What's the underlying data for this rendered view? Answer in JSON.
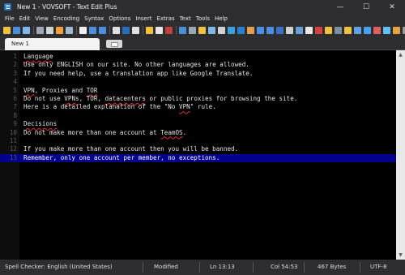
{
  "window": {
    "title": "New 1 - VOVSOFT - Text Edit Plus",
    "minimize": "—",
    "maximize": "☐",
    "close": "✕"
  },
  "menu": [
    "File",
    "Edit",
    "View",
    "Encoding",
    "Syntax",
    "Options",
    "Insert",
    "Extras",
    "Text",
    "Tools",
    "Help"
  ],
  "toolbar": {
    "icon_colors": [
      "#f0c040",
      "#4a90d9",
      "#7fb8e8",
      "#9fa8b8",
      "#cfd3d8",
      "#f2a03c",
      "#9fb8d0",
      "#f0f0f0",
      "#4a8fe0",
      "#4a8fe0",
      "#e0e0e0",
      "#2a6db8",
      "#e0e0e0",
      "#f0c040",
      "#e6e6e6",
      "#c04040",
      "#4a90d9",
      "#9aa8b6",
      "#f0c040",
      "#7fb8e8",
      "#d0d0d0",
      "#3fa0e0",
      "#2a80d0",
      "#e0a050",
      "#4a8fe0",
      "#4a8fe0",
      "#3a70c8",
      "#d0d0d0",
      "#6aa0d8",
      "#e8e8e8",
      "#d84040",
      "#f0c040",
      "#7a8fa0",
      "#f0c040",
      "#60a0e0",
      "#4aa0f0",
      "#e06060",
      "#60c0f0",
      "#e8a040",
      "#9a9a9a"
    ]
  },
  "tabs": [
    {
      "label": "New 1"
    }
  ],
  "editor": {
    "lines": [
      {
        "num": "1",
        "segments": [
          {
            "text": "Language",
            "spell": true
          }
        ]
      },
      {
        "num": "2",
        "segments": [
          {
            "text": "Use only ENGLISH on our site. No other languages are allowed."
          }
        ]
      },
      {
        "num": "3",
        "segments": [
          {
            "text": "If you need help, use a translation app like Google Translate."
          }
        ]
      },
      {
        "num": "4",
        "segments": [
          {
            "text": ""
          }
        ]
      },
      {
        "num": "5",
        "segments": [
          {
            "text": "VPN",
            "spell": true
          },
          {
            "text": ", Proxies and "
          },
          {
            "text": "TOR",
            "spell": true
          }
        ]
      },
      {
        "num": "6",
        "segments": [
          {
            "text": "Do not use "
          },
          {
            "text": "VPNs",
            "spell": true
          },
          {
            "text": ", TOR, "
          },
          {
            "text": "datacenters",
            "spell": true
          },
          {
            "text": " or public proxies for browsing the site."
          }
        ]
      },
      {
        "num": "7",
        "segments": [
          {
            "text": "Here is a detailed explanation of the \"No "
          },
          {
            "text": "VPN",
            "spell": true
          },
          {
            "text": "\" rule."
          }
        ]
      },
      {
        "num": "8",
        "segments": [
          {
            "text": ""
          }
        ]
      },
      {
        "num": "9",
        "segments": [
          {
            "text": "Decisions",
            "spell": true
          }
        ]
      },
      {
        "num": "10",
        "segments": [
          {
            "text": "Do not make more than one account at "
          },
          {
            "text": "TeamOS",
            "spell": true
          },
          {
            "text": "."
          }
        ]
      },
      {
        "num": "11",
        "segments": [
          {
            "text": ""
          }
        ]
      },
      {
        "num": "12",
        "segments": [
          {
            "text": "If you make more than one account then you will be banned."
          }
        ]
      },
      {
        "num": "13",
        "selected": true,
        "segments": [
          {
            "text": "Remember, only one account per member, no exceptions."
          }
        ]
      }
    ]
  },
  "status": {
    "spell": "Spell Checker: English (United States)",
    "modified": "Modified",
    "position": "Ln 13:13",
    "col": "Col 54:53",
    "size": "467 Bytes",
    "encoding": "UTF-8"
  }
}
